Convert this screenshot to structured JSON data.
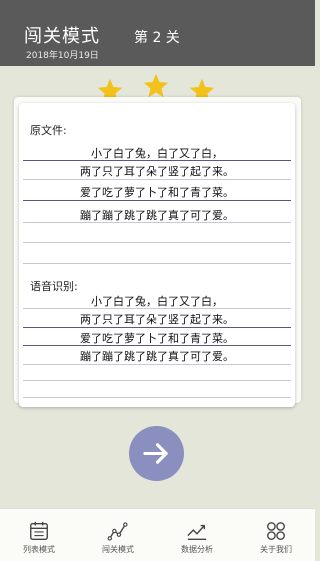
{
  "header": {
    "title": "闯关模式",
    "date": "2018年10月19日",
    "level": "第 2 关"
  },
  "colors": {
    "header_bg": "#5a5a5a",
    "page_bg": "#e3e6d9",
    "star": "#f2c21b",
    "accent": "#8b8fbf"
  },
  "rating": {
    "stars_earned": 3,
    "stars_total": 3
  },
  "original": {
    "label": "原文件:",
    "lines": [
      "小了白了兔，白了又了白，",
      "两了只了耳了朵了竖了起了来。",
      "爱了吃了萝了卜了和了青了菜。",
      "蹦了蹦了跳了跳了真了可了爱。"
    ]
  },
  "recognized": {
    "label": "语音识别:",
    "lines": [
      "小了白了兔，白了又了白，",
      "两了只了耳了朵了竖了起了来。",
      "爱了吃了萝了卜了和了青了菜。",
      "蹦了蹦了跳了跳了真了可了爱。"
    ]
  },
  "next_button": {
    "icon": "arrow-right-icon"
  },
  "nav": {
    "items": [
      {
        "label": "列表模式",
        "icon": "calendar-list-icon"
      },
      {
        "label": "闯关模式",
        "icon": "line-graph-icon"
      },
      {
        "label": "数据分析",
        "icon": "trend-chart-icon"
      },
      {
        "label": "关于我们",
        "icon": "grid-circles-icon"
      }
    ]
  }
}
